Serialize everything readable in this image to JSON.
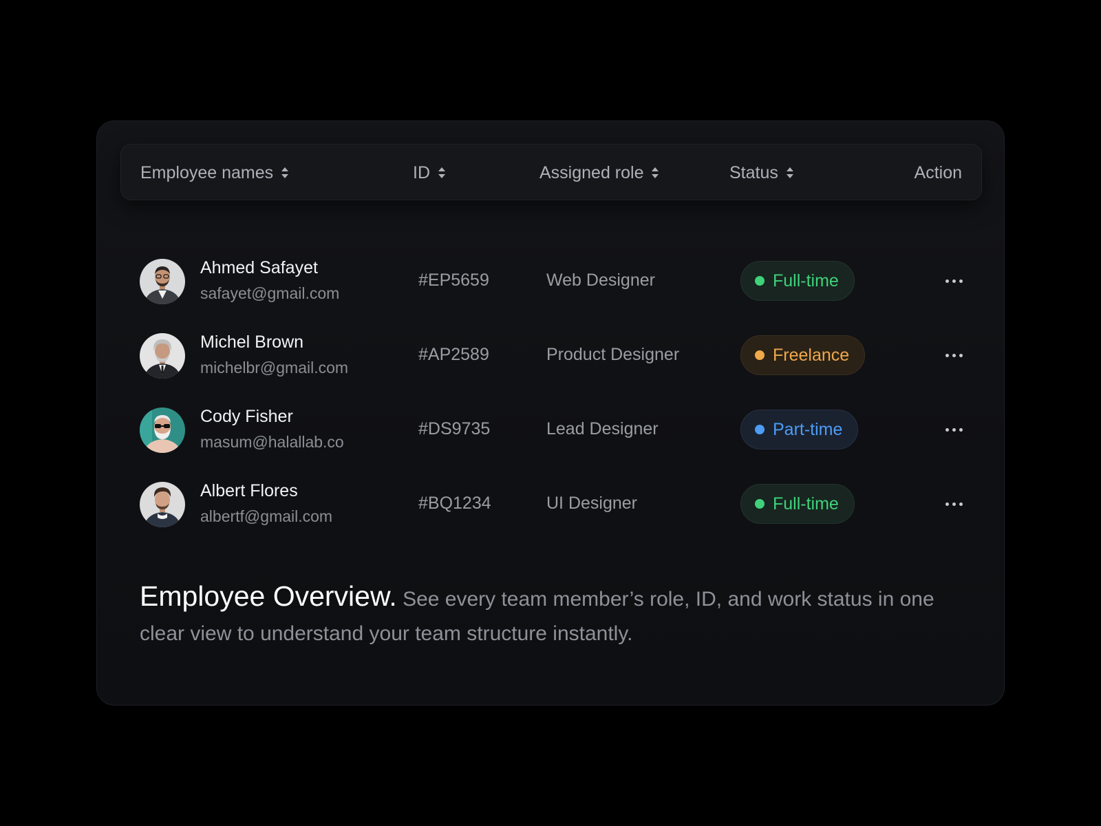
{
  "table": {
    "headers": {
      "name": "Employee names",
      "id": "ID",
      "role": "Assigned role",
      "status": "Status",
      "action": "Action"
    },
    "rows": [
      {
        "name": "Ahmed Safayet",
        "email": "safayet@gmail.com",
        "id": "#EP5659",
        "role": "Web Designer",
        "status": "Full-time",
        "status_color": "#3fd27a"
      },
      {
        "name": "Michel Brown",
        "email": "michelbr@gmail.com",
        "id": "#AP2589",
        "role": "Product Designer",
        "status": "Freelance",
        "status_color": "#f0a84a"
      },
      {
        "name": "Cody Fisher",
        "email": "masum@halallab.co",
        "id": "#DS9735",
        "role": "Lead Designer",
        "status": "Part-time",
        "status_color": "#4d9cf6"
      },
      {
        "name": "Albert Flores",
        "email": "albertf@gmail.com",
        "id": "#BQ1234",
        "role": "UI Designer",
        "status": "Full-time",
        "status_color": "#3fd27a"
      }
    ]
  },
  "overview": {
    "title": "Employee Overview.",
    "text": "See every team member’s role, ID, and work status in one clear view to understand your team structure instantly."
  },
  "colors": {
    "background": "#000000",
    "card": "#111215",
    "header": "#16171b",
    "full_time": "#3fd27a",
    "freelance": "#f0a84a",
    "part_time": "#4d9cf6"
  },
  "icons": {
    "sort": "sort-icon",
    "more": "more-horizontal-icon",
    "avatar": "avatar-photo"
  }
}
